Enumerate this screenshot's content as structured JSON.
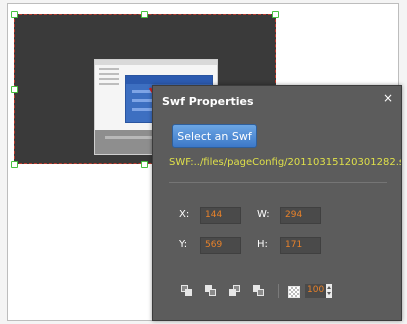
{
  "panel": {
    "title": "Swf Properties",
    "close_icon": "×",
    "select_button_label": "Select an Swf",
    "swf_path": "SWF:../files/pageConfig/20110315120301282.s"
  },
  "fields": {
    "x_label": "X:",
    "x_value": "144",
    "w_label": "W:",
    "w_value": "294",
    "y_label": "Y:",
    "y_value": "569",
    "h_label": "H:",
    "h_value": "171"
  },
  "toolbar": {
    "icons": [
      "bring-to-front-icon",
      "send-to-back-icon",
      "bring-forward-icon",
      "send-backward-icon"
    ],
    "opacity_icon": "transparency-checker-icon",
    "opacity_value": "100"
  },
  "colors": {
    "panel_bg": "#5c5c5c",
    "button_blue": "#4a86d0",
    "path_text": "#dfe04a",
    "field_value": "#e8822a",
    "selection_handle": "#47c33f",
    "arrow_red": "#d12020"
  }
}
